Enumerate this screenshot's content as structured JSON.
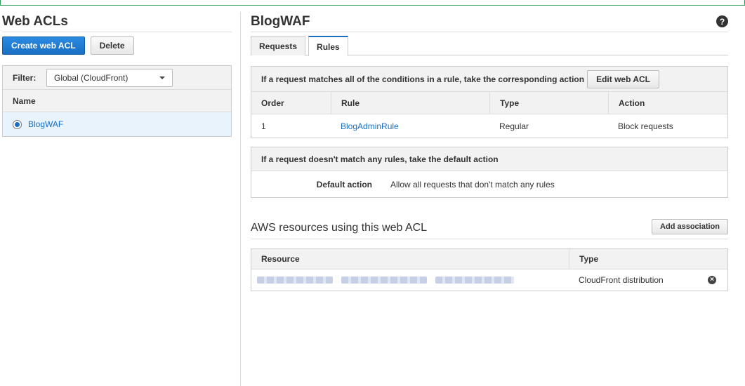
{
  "left": {
    "title": "Web ACLs",
    "create_label": "Create web ACL",
    "delete_label": "Delete",
    "filter_label": "Filter:",
    "filter_value": "Global (CloudFront)",
    "name_header": "Name",
    "acls": [
      {
        "name": "BlogWAF",
        "selected": true
      }
    ]
  },
  "detail": {
    "title": "BlogWAF",
    "help_icon": "question-circle-icon",
    "tabs": [
      {
        "label": "Requests",
        "active": false
      },
      {
        "label": "Rules",
        "active": true
      }
    ],
    "rules_box": {
      "header": "If a request matches all of the conditions in a rule, take the corresponding action",
      "edit_label": "Edit web ACL",
      "columns": [
        "Order",
        "Rule",
        "Type",
        "Action"
      ],
      "rows": [
        {
          "order": "1",
          "rule": "BlogAdminRule",
          "type": "Regular",
          "action": "Block requests"
        }
      ]
    },
    "default_box": {
      "header": "If a request doesn't match any rules, take the default action",
      "label": "Default action",
      "value": "Allow all requests that don't match any rules"
    },
    "resources": {
      "title": "AWS resources using this web ACL",
      "add_label": "Add association",
      "columns": [
        "Resource",
        "Type"
      ],
      "rows": [
        {
          "resource_redacted": true,
          "type": "CloudFront distribution",
          "remove_icon": "remove-circle-icon"
        }
      ]
    }
  },
  "colors": {
    "accent": "#1a6fc4",
    "selected_row": "#e8f3fb",
    "header_bg": "#f2f2f2",
    "border": "#cccccc"
  }
}
